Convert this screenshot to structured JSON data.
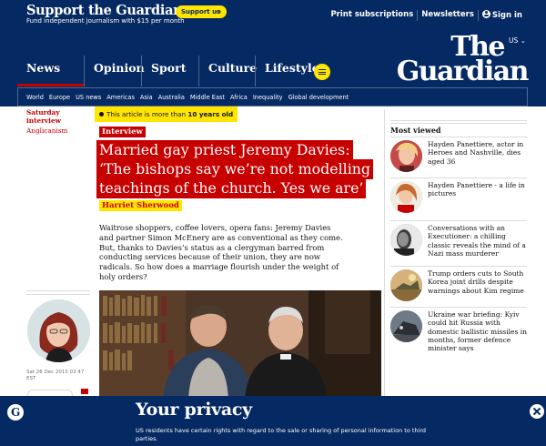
{
  "support": {
    "title": "Support the Guardian",
    "subtitle": "Fund independent journalism with $15 per month",
    "button_label": "Support us",
    "button_arrow": "→"
  },
  "top_links": {
    "print": "Print subscriptions",
    "newsletters": "Newsletters",
    "sign_in": "Sign in"
  },
  "edition": "US",
  "logo": {
    "line1": "The",
    "line2": "Guardian"
  },
  "pillars": [
    {
      "label": "News"
    },
    {
      "label": "Opinion"
    },
    {
      "label": "Sport"
    },
    {
      "label": "Culture"
    },
    {
      "label": "Lifestyle"
    }
  ],
  "subnav": [
    "World",
    "Europe",
    "US news",
    "Americas",
    "Asia",
    "Australia",
    "Middle East",
    "Africa",
    "Inequality",
    "Global development"
  ],
  "section": {
    "primary": "Saturday interview",
    "secondary": "Anglicanism"
  },
  "dateline": {
    "line1": "Sat 26 Dec 2015 03.47",
    "line2": "EST"
  },
  "age_warning": {
    "prefix": "This article is more than ",
    "bold": "10 years old"
  },
  "article": {
    "kicker": "Interview",
    "headline": "Married gay priest Jeremy Davies: ‘The bishops say we’re not modelling teachings of the church. Yes we are’",
    "byline": "Harriet Sherwood",
    "standfirst": "Waitrose shoppers, coffee lovers, opera fans: Jeremy Davies and partner Simon McEnery are as conventional as they come. But, thanks to Davies’s status as a clergyman barred from conducting services because of their union, they are now radicals. So how does a marriage flourish under the weight of holy orders?"
  },
  "most_viewed": {
    "title": "Most viewed",
    "items": [
      {
        "text": "Hayden Panettiere, actor in Heroes and Nashville, dies aged 36"
      },
      {
        "text": "Hayden Panettiere - a life in pictures"
      },
      {
        "text": "Conversations with an Executioner: a chilling classic reveals the mind of a Nazi mass murderer"
      },
      {
        "text": "Trump orders cuts to South Korea joint drills despite warnings about Kim regime"
      },
      {
        "text": "Ukraine war briefing: Kyiv could hit Russia with domestic ballistic missiles in months, former defence minister says"
      }
    ]
  },
  "privacy": {
    "title": "Your privacy",
    "text": "US residents have certain rights with regard to the sale or sharing of personal information to third parties."
  },
  "colors": {
    "brand_blue": "#052962",
    "news_red": "#c70000",
    "highlight_yellow": "#ffe500"
  }
}
